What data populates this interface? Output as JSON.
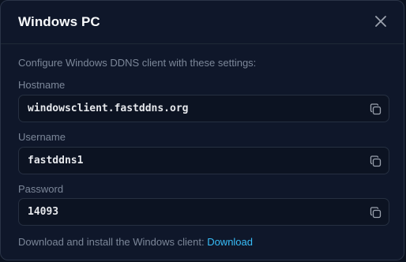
{
  "dialog": {
    "title": "Windows PC"
  },
  "intro_text": "Configure Windows DDNS client with these settings:",
  "fields": [
    {
      "label": "Hostname",
      "value": "windowsclient.fastddns.org"
    },
    {
      "label": "Username",
      "value": "fastddns1"
    },
    {
      "label": "Password",
      "value": "14093"
    }
  ],
  "footer": {
    "text": "Download and install the Windows client: ",
    "link_label": "Download"
  },
  "icons": {
    "close": "close-icon",
    "copy": "copy-icon"
  },
  "colors": {
    "background": "#0f172a",
    "link": "#38bdf8",
    "muted_text": "#7c8799"
  }
}
